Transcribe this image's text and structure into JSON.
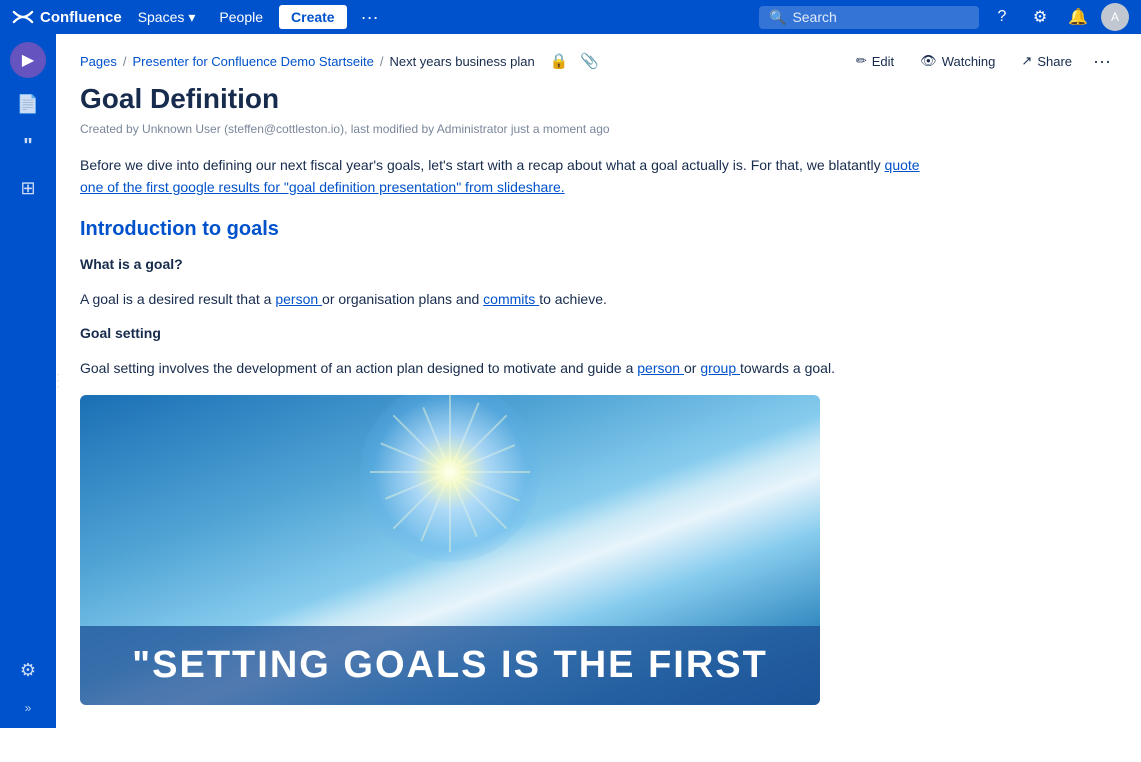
{
  "topnav": {
    "logo_text": "Confluence",
    "spaces_label": "Spaces",
    "people_label": "People",
    "create_label": "Create",
    "more_label": "···",
    "search_placeholder": "Search",
    "search_icon": "🔍",
    "help_icon": "?",
    "settings_icon": "⚙",
    "notifications_icon": "🔔",
    "avatar_initials": "A"
  },
  "sidebar": {
    "presenter_icon": "▶",
    "page_icon": "📄",
    "quote_icon": "❝",
    "table_icon": "⊞",
    "settings_icon": "⚙",
    "collapse_icon": "»"
  },
  "breadcrumb": {
    "pages_label": "Pages",
    "space_label": "Presenter for Confluence Demo Startseite",
    "page_label": "Next years business plan",
    "restrict_icon": "🔒",
    "attach_icon": "📎"
  },
  "actions": {
    "edit_icon": "✏",
    "edit_label": "Edit",
    "watch_icon": "👁",
    "watch_label": "Watching",
    "share_icon": "↗",
    "share_label": "Share",
    "more_icon": "···"
  },
  "page": {
    "title": "Goal Definition",
    "meta": "Created by Unknown User (steffen@cottleston.io), last modified by Administrator just a moment ago",
    "intro": "Before we dive into defining our next fiscal year's goals, let's start with a recap about what a goal actually is. For that, we blatantly",
    "intro_link": "quote one of the first google results for \"goal definition presentation\" from slideshare.",
    "section_heading": "Introduction to goals",
    "subsection1_heading": "What is a goal?",
    "subsection1_body": "A goal is a desired result that a",
    "person_link": "person",
    "subsection1_body2": "or organisation plans and",
    "commits_link": "commits",
    "subsection1_body3": "to achieve.",
    "subsection2_heading": "Goal setting",
    "subsection2_body": "Goal setting involves the development of an action plan designed to motivate and guide a",
    "person2_link": "person",
    "subsection2_body2": "or",
    "group_link": "group",
    "subsection2_body3": "towards a goal.",
    "image_caption": "\"SETTING GOALS IS THE FIRST"
  }
}
